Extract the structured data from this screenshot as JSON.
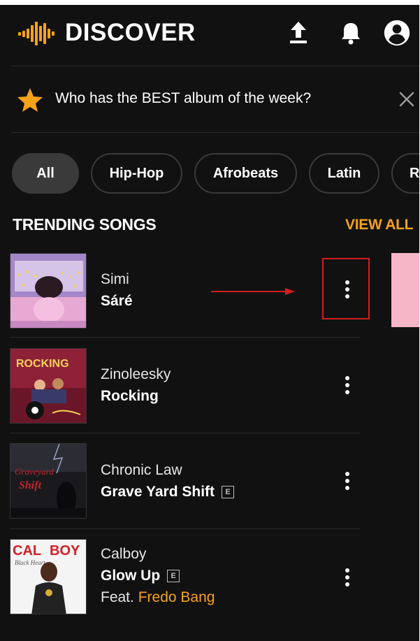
{
  "header": {
    "title": "DISCOVER",
    "icons": [
      "audiomack-logo-icon",
      "upload-icon",
      "bell-icon",
      "account-icon"
    ],
    "brand_color": "#f7a21b"
  },
  "banner": {
    "text": "Who has the BEST album of the week?",
    "icons": [
      "star-icon",
      "close-icon"
    ]
  },
  "chips": [
    {
      "label": "All",
      "active": true
    },
    {
      "label": "Hip-Hop",
      "active": false
    },
    {
      "label": "Afrobeats",
      "active": false
    },
    {
      "label": "Latin",
      "active": false
    },
    {
      "label": "R",
      "active": false
    }
  ],
  "section": {
    "title": "TRENDING SONGS",
    "view_all": "VIEW ALL"
  },
  "songs": [
    {
      "artist": "Simi",
      "title": "Sáré",
      "explicit": false,
      "feat_prefix": "",
      "feat": ""
    },
    {
      "artist": "Zinoleesky",
      "title": "Rocking",
      "explicit": false,
      "feat_prefix": "",
      "feat": ""
    },
    {
      "artist": "Chronic Law",
      "title": "Grave Yard Shift",
      "explicit": true,
      "explicit_label": "E",
      "feat_prefix": "",
      "feat": ""
    },
    {
      "artist": "Calboy",
      "title": "Glow Up",
      "explicit": true,
      "explicit_label": "E",
      "feat_prefix": "Feat. ",
      "feat": "Fredo Bang"
    }
  ],
  "explicit_label": "E",
  "annotation": {
    "color": "#d21f1f"
  },
  "colors": {
    "background": "#111111",
    "accent": "#f7a21b",
    "chip_active": "#3a3a3a"
  }
}
